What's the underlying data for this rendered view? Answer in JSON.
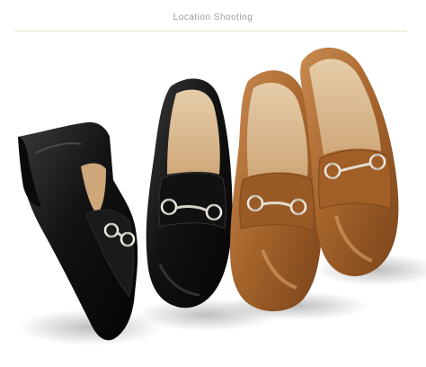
{
  "page": {
    "title": "Location Shooting"
  },
  "image": {
    "subject": "loafers",
    "items": [
      {
        "name": "black-loafer-side",
        "color": "#1b1b1b"
      },
      {
        "name": "black-loafer-front",
        "color": "#151515"
      },
      {
        "name": "tan-loafer-left",
        "color": "#a4632a"
      },
      {
        "name": "tan-loafer-right",
        "color": "#a9652b"
      }
    ],
    "accent_colors": {
      "header_rule": "#e9e1cf",
      "title_text": "#9a9a9a",
      "insole": "#d8b98b",
      "hardware": "#d7d3c8"
    }
  }
}
